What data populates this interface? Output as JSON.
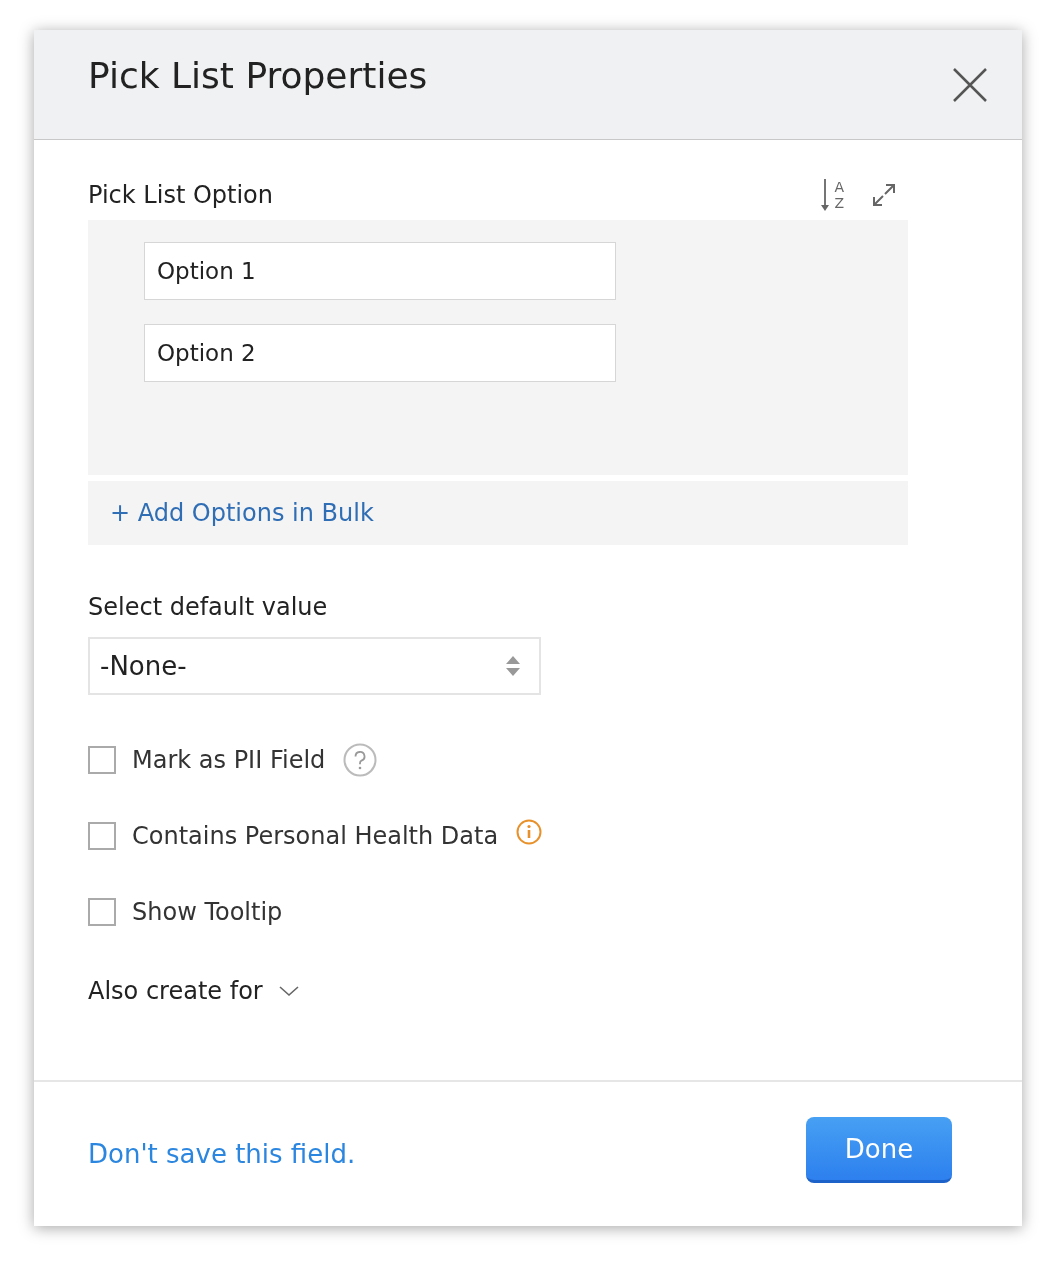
{
  "dialog": {
    "title": "Pick List Properties"
  },
  "options_section": {
    "label": "Pick List Option",
    "sort_letters": [
      "A",
      "Z"
    ],
    "options": [
      {
        "value": "Option 1"
      },
      {
        "value": "Option 2"
      }
    ],
    "bulk_link": "+ Add Options in Bulk"
  },
  "default_value": {
    "label": "Select default value",
    "value": "-None-"
  },
  "checkboxes": [
    {
      "label": "Mark as PII Field",
      "checked": false,
      "kind": "help"
    },
    {
      "label": "Contains Personal Health Data",
      "checked": false,
      "kind": "info"
    },
    {
      "label": "Show Tooltip",
      "checked": false,
      "kind": "plain"
    }
  ],
  "also_create": {
    "label": "Also create for",
    "expanded": false
  },
  "footer": {
    "link": "Don't save this field.",
    "button": "Done"
  }
}
